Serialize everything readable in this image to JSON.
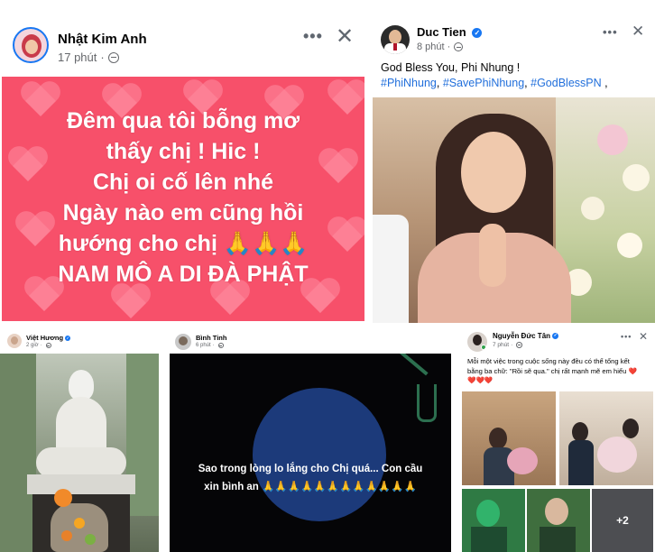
{
  "post1": {
    "author": "Nhật Kim Anh",
    "time": "17 phút",
    "image_text": [
      "Đêm qua tôi bỗng mơ",
      "thấy chị ! Hic !",
      "Chị oi cố lên nhé",
      "Ngày nào em cũng hồi",
      "hướng cho chị 🙏🙏🙏",
      "NAM MÔ A DI ĐÀ PHẬT"
    ]
  },
  "post2": {
    "author": "Duc Tien",
    "time": "8 phút",
    "text": "God Bless You, Phi Nhung !",
    "hashtags": [
      "#PhiNhung",
      "#SavePhiNhung",
      "#GodBlessPN"
    ]
  },
  "post3": {
    "author": "Việt Hương",
    "time": "2 giờ"
  },
  "post4": {
    "author": "Bình Tinh",
    "time": "6 phút",
    "image_text": [
      "Sao trong lòng lo lắng cho Chị quá... Con cầu",
      "xin bình an 🙏🙏🙏🙏🙏🙏🙏🙏🙏🙏🙏🙏"
    ]
  },
  "post5": {
    "author": "Nguyễn Đức Tân",
    "time": "7 phút",
    "text": "Mỗi một việc trong cuộc sống này đều có thể tổng kết bằng ba chữ: \"Rồi sẽ qua.\" chị rất mạnh mẽ em hiểu ❤️❤️❤️❤️",
    "more_photos": "+2"
  },
  "colors": {
    "accent": "#1877f2",
    "hashtag": "#216fdb",
    "pink_bg": "#f7506a"
  },
  "icons": {
    "more": "more-icon",
    "close": "close-icon",
    "globe": "globe-icon",
    "verified": "verified-icon"
  }
}
